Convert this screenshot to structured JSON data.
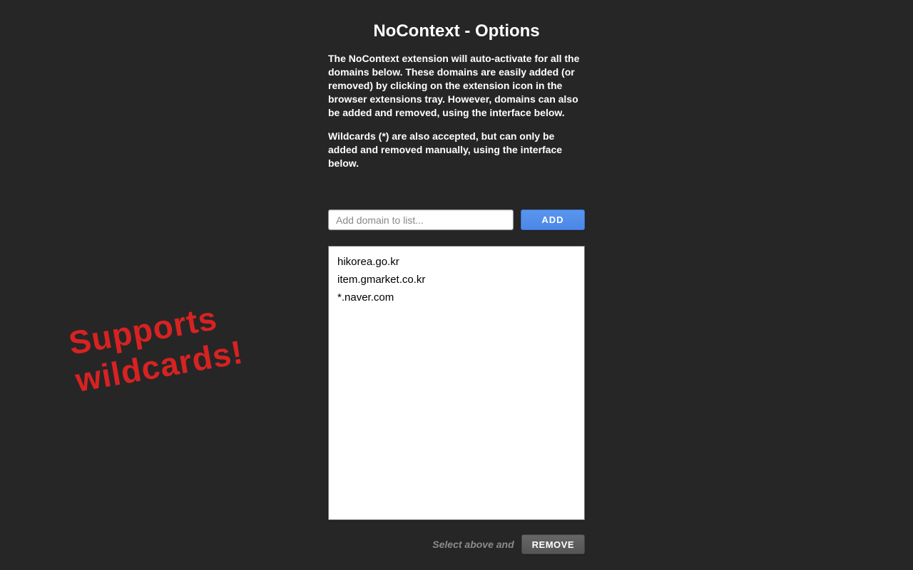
{
  "header": {
    "title": "NoContext - Options",
    "description1": "The NoContext extension will auto-activate for all the domains below. These domains are easily added (or removed) by clicking on the extension icon in the browser extensions tray. However, domains can also be added and removed, using the interface below.",
    "description2": "Wildcards (*) are also accepted, but can only be added and removed manually, using the interface below."
  },
  "input": {
    "placeholder": "Add domain to list...",
    "add_label": "ADD"
  },
  "domains": {
    "items": [
      "hikorea.go.kr",
      "item.gmarket.co.kr",
      "*.naver.com"
    ]
  },
  "remove": {
    "hint": "Select above and",
    "button_label": "REMOVE"
  },
  "callout": {
    "line1": "Supports",
    "line2": "wildcards!"
  }
}
